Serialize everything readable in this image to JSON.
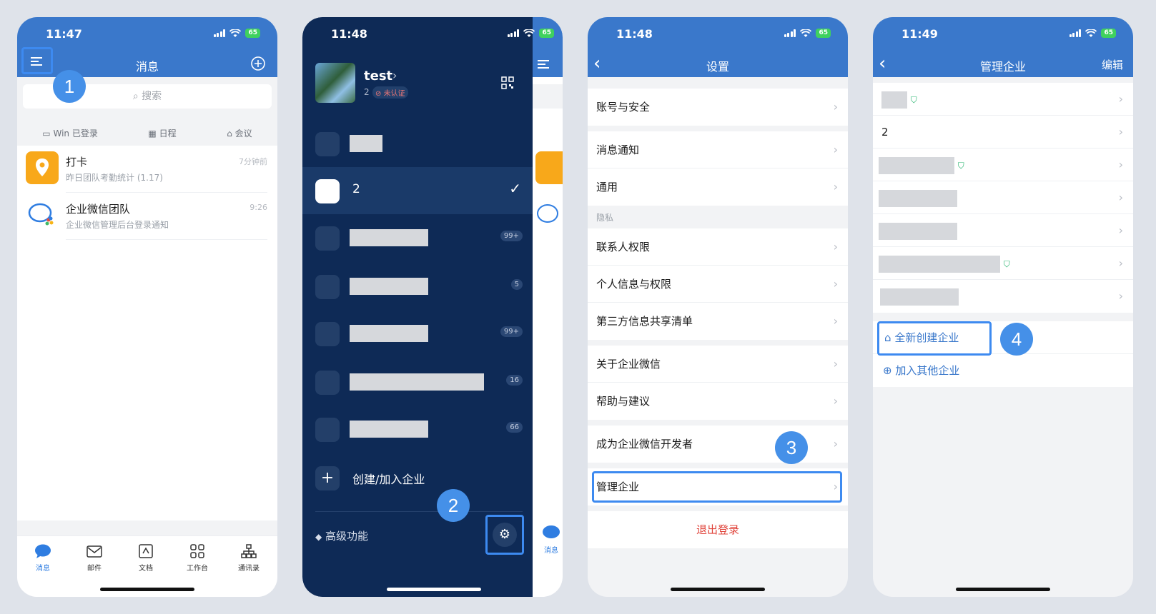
{
  "phone1": {
    "time": "11:47",
    "battery": "65",
    "title": "消息",
    "search_placeholder": "搜索",
    "quick": [
      "Win 已登录",
      "日程",
      "会议"
    ],
    "messages": [
      {
        "name": "打卡",
        "sub": "昨日团队考勤统计 (1.17)",
        "time": "7分钟前"
      },
      {
        "name": "企业微信团队",
        "sub": "企业微信管理后台登录通知",
        "time": "9:26"
      }
    ],
    "tabs": [
      "消息",
      "邮件",
      "文档",
      "工作台",
      "通讯录"
    ],
    "callout": "1"
  },
  "phone2": {
    "time": "11:48",
    "battery": "65",
    "user_name": "test",
    "user_id": "2",
    "unverified": "未认证",
    "corps": [
      {
        "name": "",
        "badge": ""
      },
      {
        "name": "2",
        "badge": ""
      },
      {
        "name": "",
        "badge": "99+"
      },
      {
        "name": "",
        "badge": "5"
      },
      {
        "name": "",
        "badge": "99+"
      },
      {
        "name": "",
        "badge": "16"
      },
      {
        "name": "",
        "badge": "66"
      }
    ],
    "create_join": "创建/加入企业",
    "advanced": "高级功能",
    "peek_tab": "消息",
    "callout": "2"
  },
  "phone3": {
    "time": "11:48",
    "battery": "65",
    "title": "设置",
    "group1": [
      "账号与安全"
    ],
    "group2": [
      "消息通知",
      "通用"
    ],
    "privacy_label": "隐私",
    "group3": [
      "联系人权限",
      "个人信息与权限",
      "第三方信息共享清单"
    ],
    "group4": [
      "关于企业微信",
      "帮助与建议"
    ],
    "group5": [
      "成为企业微信开发者"
    ],
    "group6": [
      "管理企业"
    ],
    "logout": "退出登录",
    "callout": "3"
  },
  "phone4": {
    "time": "11:49",
    "battery": "65",
    "title": "管理企业",
    "edit": "编辑",
    "corp_second": "2",
    "create_new": "全新创建企业",
    "join_other": "加入其他企业",
    "callout": "4"
  },
  "colors": {
    "header_blue": "#3a78cb",
    "drawer_navy": "#0e2a56",
    "callout_blue": "#4590e8",
    "logout_red": "#e0433a",
    "verified_green": "#22b36b"
  }
}
